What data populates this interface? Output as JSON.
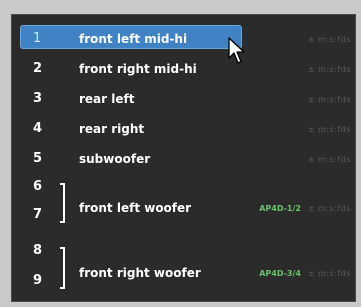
{
  "channels": [
    {
      "number": "1",
      "label": "front left mid-hi",
      "time": "± m:s:fds"
    },
    {
      "number": "2",
      "label": "front right mid-hi",
      "time": "± m:s:fds"
    },
    {
      "number": "3",
      "label": "rear left",
      "time": "± m:s:fds"
    },
    {
      "number": "4",
      "label": "rear right",
      "time": "± m:s:fds"
    },
    {
      "number": "5",
      "label": "subwoofer",
      "time": "± m:s:fds"
    }
  ],
  "pairs": [
    {
      "numbers": [
        "6",
        "7"
      ],
      "label": "front left woofer",
      "device": "AP4D-1/2",
      "time": "± m:s:fds"
    },
    {
      "numbers": [
        "8",
        "9"
      ],
      "label": "front right woofer",
      "device": "AP4D-3/4",
      "time": "± m:s:fds"
    }
  ],
  "selected_channel": "1",
  "colors": {
    "background": "#2b2b2b",
    "selection": "#3f83c4",
    "device_label": "#6cc06c",
    "dim_text": "#5a5a5a"
  },
  "icons": {
    "pointer": "arrow-cursor-icon"
  }
}
